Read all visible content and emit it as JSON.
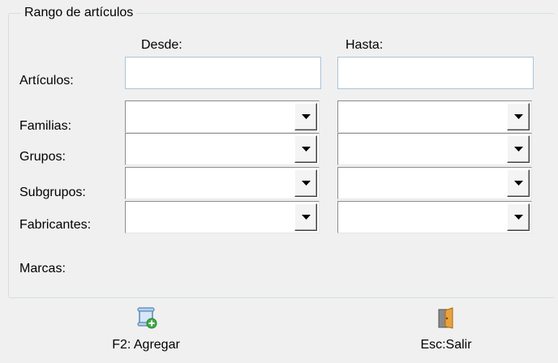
{
  "group": {
    "caption": "Rango de artículos"
  },
  "columns": {
    "from": "Desde:",
    "to": "Hasta:"
  },
  "rows": {
    "articulos": "Artículos:",
    "familias": "Familias:",
    "grupos": "Grupos:",
    "subgrupos": "Subgrupos:",
    "fabricantes": "Fabricantes:",
    "marcas": "Marcas:"
  },
  "fields": {
    "articulos_from": "",
    "articulos_to": ""
  },
  "combos": {
    "familias_from": "",
    "familias_to": "",
    "grupos_from": "",
    "grupos_to": "",
    "subgrupos_from": "",
    "subgrupos_to": "",
    "fabricantes_from": "",
    "fabricantes_to": ""
  },
  "toolbar": {
    "add": {
      "label": "F2: Agregar",
      "icon": "scroll-add-icon"
    },
    "exit": {
      "label": "Esc:Salir",
      "icon": "door-exit-icon"
    }
  }
}
